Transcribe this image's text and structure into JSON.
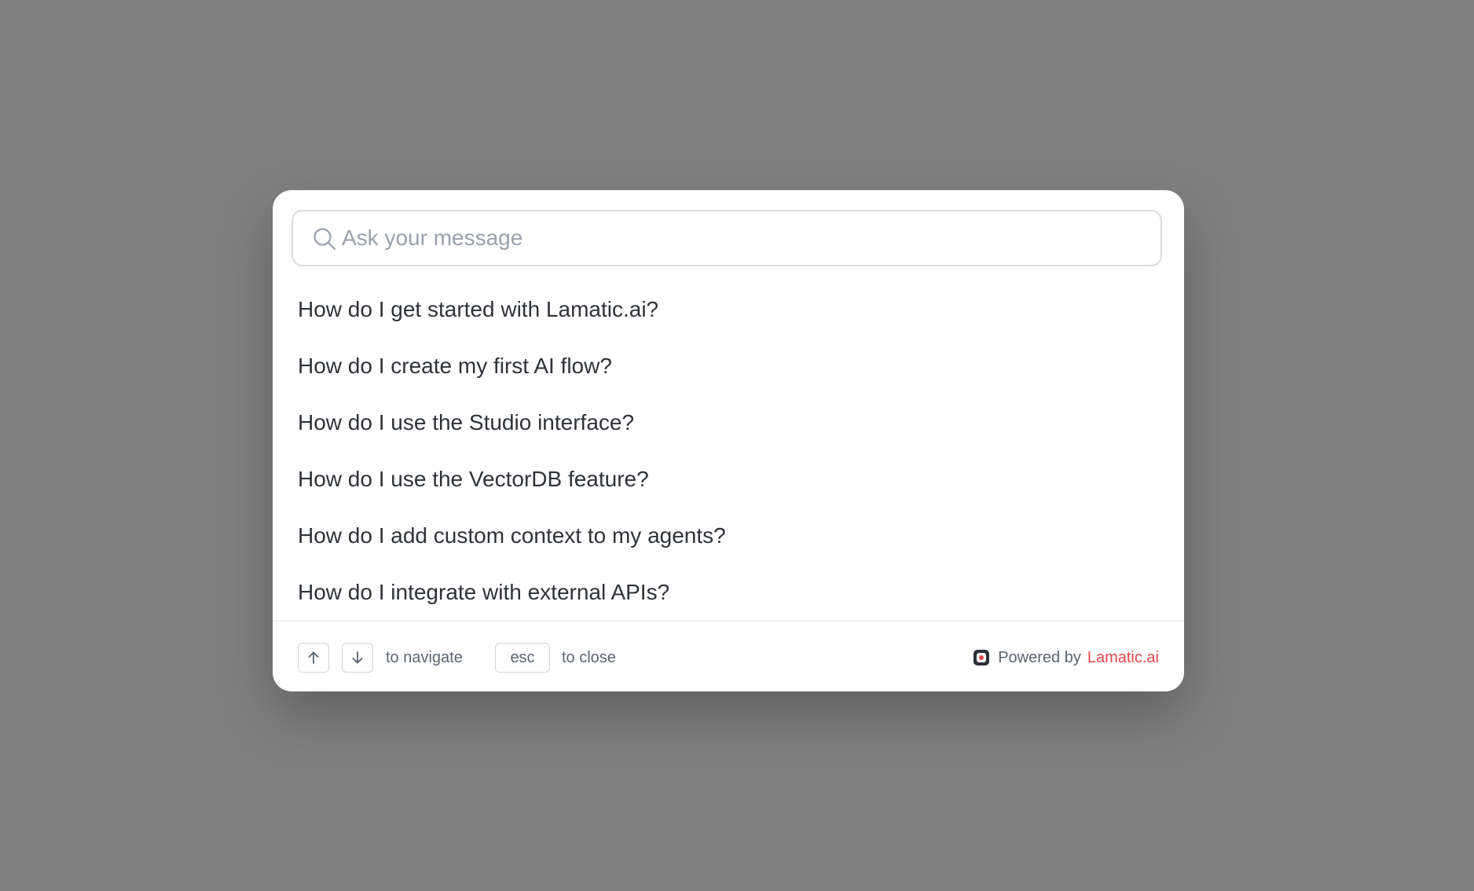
{
  "search": {
    "placeholder": "Ask your message",
    "value": "",
    "icon": "search-icon"
  },
  "suggestions": [
    "How do I get started with Lamatic.ai?",
    "How do I create my first AI flow?",
    "How do I use the Studio interface?",
    "How do I use the VectorDB feature?",
    "How do I add custom context to my agents?",
    "How do I integrate with external APIs?"
  ],
  "footer": {
    "up_key_icon": "arrow-up-icon",
    "down_key_icon": "arrow-down-icon",
    "navigate_hint": "to navigate",
    "esc_key": "esc",
    "close_hint": "to close",
    "powered_by": "Powered by",
    "brand": "Lamatic.ai",
    "brand_color": "#e5484d"
  },
  "colors": {
    "backdrop": "#808080",
    "modal": "#ffffff",
    "text": "#2f3338",
    "muted": "#5b6470",
    "border": "#d9dce1"
  }
}
